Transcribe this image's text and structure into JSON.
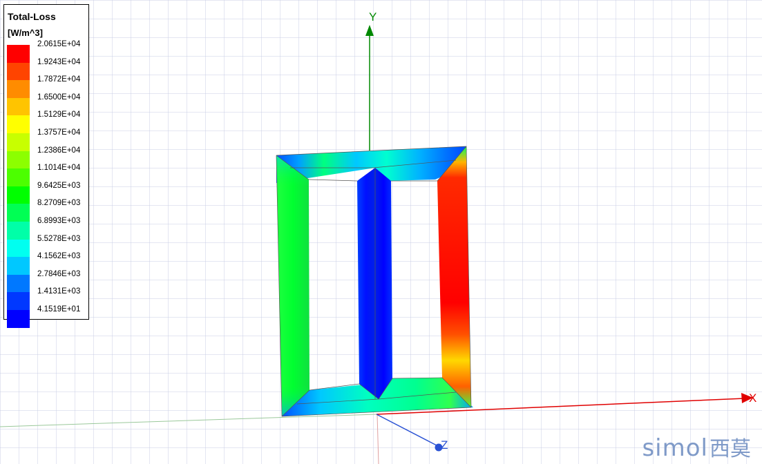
{
  "legend": {
    "title": "Total-Loss",
    "unit": "[W/m^3]",
    "ticks": [
      "2.0615E+04",
      "1.9243E+04",
      "1.7872E+04",
      "1.6500E+04",
      "1.5129E+04",
      "1.3757E+04",
      "1.2386E+04",
      "1.1014E+04",
      "9.6425E+03",
      "8.2709E+03",
      "6.8993E+03",
      "5.5278E+03",
      "4.1562E+03",
      "2.7846E+03",
      "1.4131E+03",
      "4.1519E+01"
    ],
    "colors": [
      "#ff0000",
      "#ff4400",
      "#ff8c00",
      "#ffc400",
      "#ffff00",
      "#c8ff00",
      "#8cff00",
      "#4cff00",
      "#00ff00",
      "#00ff54",
      "#00ffa8",
      "#00fff0",
      "#00c8ff",
      "#0078ff",
      "#0038ff",
      "#0000ff"
    ]
  },
  "axes": {
    "x_label": "X",
    "y_label": "Y",
    "z_label": "Z",
    "x_color": "#e00000",
    "y_color": "#008800",
    "z_color": "#2a52d4"
  },
  "watermark": {
    "latin": "simol",
    "cjk": "西莫"
  }
}
